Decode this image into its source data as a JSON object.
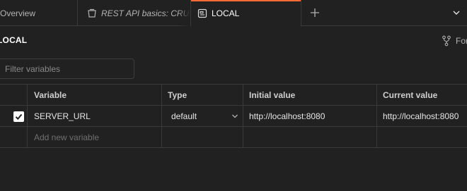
{
  "tabs": {
    "overview_label": "Overview",
    "rest_label": "REST API basics: CRUD, test & variable",
    "local_label": "LOCAL"
  },
  "header": {
    "title": "LOCAL",
    "fork_label": "Fork"
  },
  "filter": {
    "placeholder": "Filter variables"
  },
  "table": {
    "columns": {
      "variable": "Variable",
      "type": "Type",
      "initial": "Initial value",
      "current": "Current value"
    },
    "rows": [
      {
        "enabled": true,
        "variable": "SERVER_URL",
        "type": "default",
        "initial": "http://localhost:8080",
        "current": "http://localhost:8080"
      }
    ],
    "add_placeholder": "Add new variable"
  },
  "colors": {
    "background": "#212121",
    "accent": "#ff6c37",
    "border": "#3a3a3a"
  },
  "icons": {
    "rest_tab": "collection-icon",
    "local_tab": "environment-icon",
    "new_tab": "plus-icon",
    "tab_menu": "chevron-down-icon",
    "fork": "fork-icon",
    "type_select": "chevron-down-icon",
    "checkbox": "check-icon"
  }
}
